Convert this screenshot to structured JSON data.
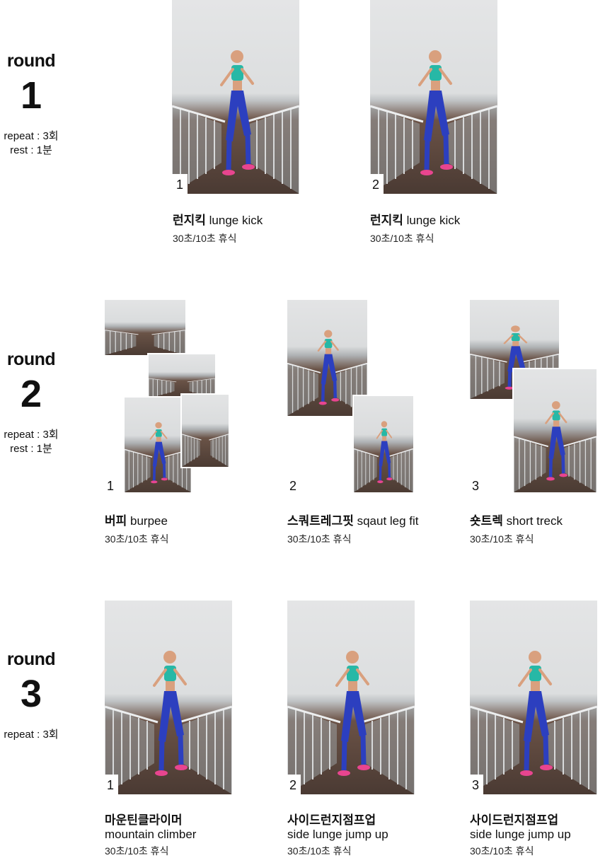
{
  "rounds": [
    {
      "word": "round",
      "number": "1",
      "repeat": "repeat : 3회",
      "rest": "rest : 1분"
    },
    {
      "word": "round",
      "number": "2",
      "repeat": "repeat : 3회",
      "rest": "rest : 1분"
    },
    {
      "word": "round",
      "number": "3",
      "repeat": "repeat : 3회"
    }
  ],
  "exercises": {
    "r1_1": {
      "badge": "1",
      "title_ko": "런지킥",
      "title_en": "lunge kick",
      "timing": "30초/10초 휴식"
    },
    "r1_2": {
      "badge": "2",
      "title_ko": "런지킥",
      "title_en": "lunge kick",
      "timing": "30초/10초 휴식"
    },
    "r2_1": {
      "badge": "1",
      "title_ko": "버피",
      "title_en": "burpee",
      "timing": "30초/10초 휴식"
    },
    "r2_2": {
      "badge": "2",
      "title_ko": "스쿼트레그핏",
      "title_en": "sqaut leg fit",
      "timing": "30초/10초 휴식"
    },
    "r2_3": {
      "badge": "3",
      "title_ko": "숏트렉",
      "title_en": "short treck",
      "timing": "30초/10초 휴식"
    },
    "r3_1": {
      "badge": "1",
      "title_ko": "마운틴클라이머",
      "title_en": "mountain climber",
      "timing": "30초/10초 휴식"
    },
    "r3_2": {
      "badge": "2",
      "title_ko": "사이드런지점프업",
      "title_en": "side lunge jump up",
      "timing": "30초/10초 휴식"
    },
    "r3_3": {
      "badge": "3",
      "title_ko": "사이드런지점프업",
      "title_en": "side lunge jump up",
      "timing": "30초/10초 휴식"
    }
  },
  "icons": {
    "photo": "exercise-photo"
  },
  "colors": {
    "top": "#27b8a6",
    "pants": "#2c3fbf",
    "shoes": "#e8458f",
    "skin": "#d9a07e",
    "deck": "#4a3a33",
    "sky": "#e4e5e6"
  }
}
